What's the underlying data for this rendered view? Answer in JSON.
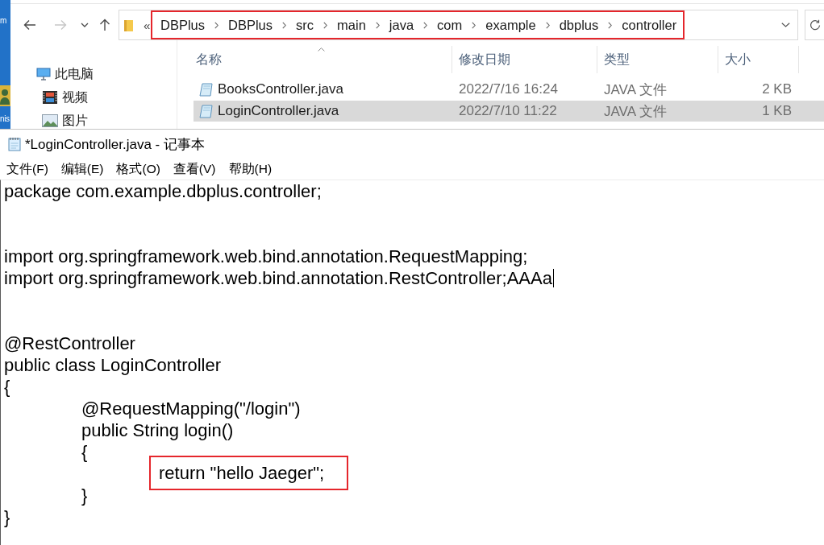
{
  "desktop": {
    "icon_labels": [
      "m",
      "nis"
    ]
  },
  "explorer": {
    "nav_buttons": [
      {
        "kind": "back",
        "disabled": false
      },
      {
        "kind": "forward",
        "disabled": true
      },
      {
        "kind": "recent",
        "disabled": false
      },
      {
        "kind": "up",
        "disabled": false
      }
    ],
    "address": {
      "overflow": "«",
      "highlighted": true,
      "segments": [
        "DBPlus",
        "DBPlus",
        "src",
        "main",
        "java",
        "com",
        "example",
        "dbplus",
        "controller"
      ]
    },
    "sidebar": {
      "items": [
        {
          "label": "此电脑",
          "kind": "computer",
          "children": [
            {
              "label": "视频",
              "kind": "videos"
            },
            {
              "label": "图片",
              "kind": "pictures"
            }
          ]
        }
      ]
    },
    "table": {
      "columns": [
        {
          "label": "名称",
          "sorted": true
        },
        {
          "label": "修改日期",
          "sorted": false
        },
        {
          "label": "类型",
          "sorted": false
        },
        {
          "label": "大小",
          "sorted": false
        }
      ],
      "rows": [
        {
          "name": "BooksController.java",
          "modified": "2022/7/16 16:24",
          "type": "JAVA 文件",
          "size": "2 KB",
          "selected": false
        },
        {
          "name": "LoginController.java",
          "modified": "2022/7/10 11:22",
          "type": "JAVA 文件",
          "size": "1 KB",
          "selected": true
        }
      ]
    }
  },
  "notepad": {
    "title": "*LoginController.java - 记事本",
    "menu": [
      "文件(F)",
      "编辑(E)",
      "格式(O)",
      "查看(V)",
      "帮助(H)"
    ],
    "lines": [
      {
        "kind": "code",
        "text": "package com.example.dbplus.controller;",
        "cursor": false,
        "highlighted": false
      },
      {
        "kind": "blank"
      },
      {
        "kind": "blank"
      },
      {
        "kind": "code",
        "text": "import org.springframework.web.bind.annotation.RequestMapping;",
        "cursor": false,
        "highlighted": false
      },
      {
        "kind": "code",
        "text": "import org.springframework.web.bind.annotation.RestController;AAAa",
        "cursor": true,
        "highlighted": false
      },
      {
        "kind": "blank"
      },
      {
        "kind": "blank"
      },
      {
        "kind": "code",
        "text": "@RestController",
        "cursor": false,
        "highlighted": false
      },
      {
        "kind": "code",
        "text": "public class LoginController",
        "cursor": false,
        "highlighted": false
      },
      {
        "kind": "code",
        "text": "{",
        "cursor": false,
        "highlighted": false,
        "children": [
          {
            "kind": "code",
            "text": "@RequestMapping(\"/login\")",
            "cursor": false,
            "highlighted": false
          },
          {
            "kind": "code",
            "text": "public String login()",
            "cursor": false,
            "highlighted": false
          },
          {
            "kind": "code",
            "text": "{",
            "cursor": false,
            "highlighted": false,
            "children": [
              {
                "kind": "code",
                "text": "return \"hello Jaeger\";",
                "cursor": false,
                "highlighted": true
              }
            ]
          },
          {
            "kind": "code",
            "text": "}",
            "cursor": false,
            "highlighted": false
          }
        ]
      },
      {
        "kind": "code",
        "text": "}",
        "cursor": false,
        "highlighted": false
      }
    ]
  }
}
